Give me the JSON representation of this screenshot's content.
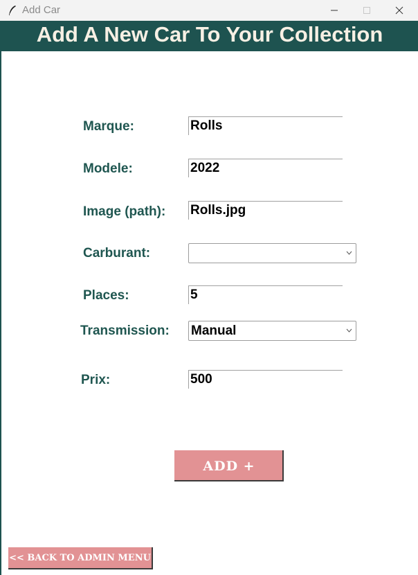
{
  "window": {
    "title": "Add Car",
    "controls": [
      "minimize-icon",
      "maximize-icon",
      "close-icon"
    ]
  },
  "header": {
    "title": "Add A New Car To Your Collection",
    "background": "#1e5350",
    "text_color": "#f7f0e4"
  },
  "form": {
    "marque": {
      "label": "Marque:",
      "value": "Rolls"
    },
    "modele": {
      "label": "Modele:",
      "value": "2022"
    },
    "image": {
      "label": "Image (path):",
      "value": "Rolls.jpg"
    },
    "carburant": {
      "label": "Carburant:",
      "value": ""
    },
    "places": {
      "label": "Places:",
      "value": "5"
    },
    "transmission": {
      "label": "Transmission:",
      "value": "Manual"
    },
    "prix": {
      "label": "Prix:",
      "value": "500"
    },
    "label_color": "#1f5650"
  },
  "buttons": {
    "add_label": "ADD +",
    "back_label": "<< BACK TO ADMIN MENU",
    "color": "#e29294"
  }
}
